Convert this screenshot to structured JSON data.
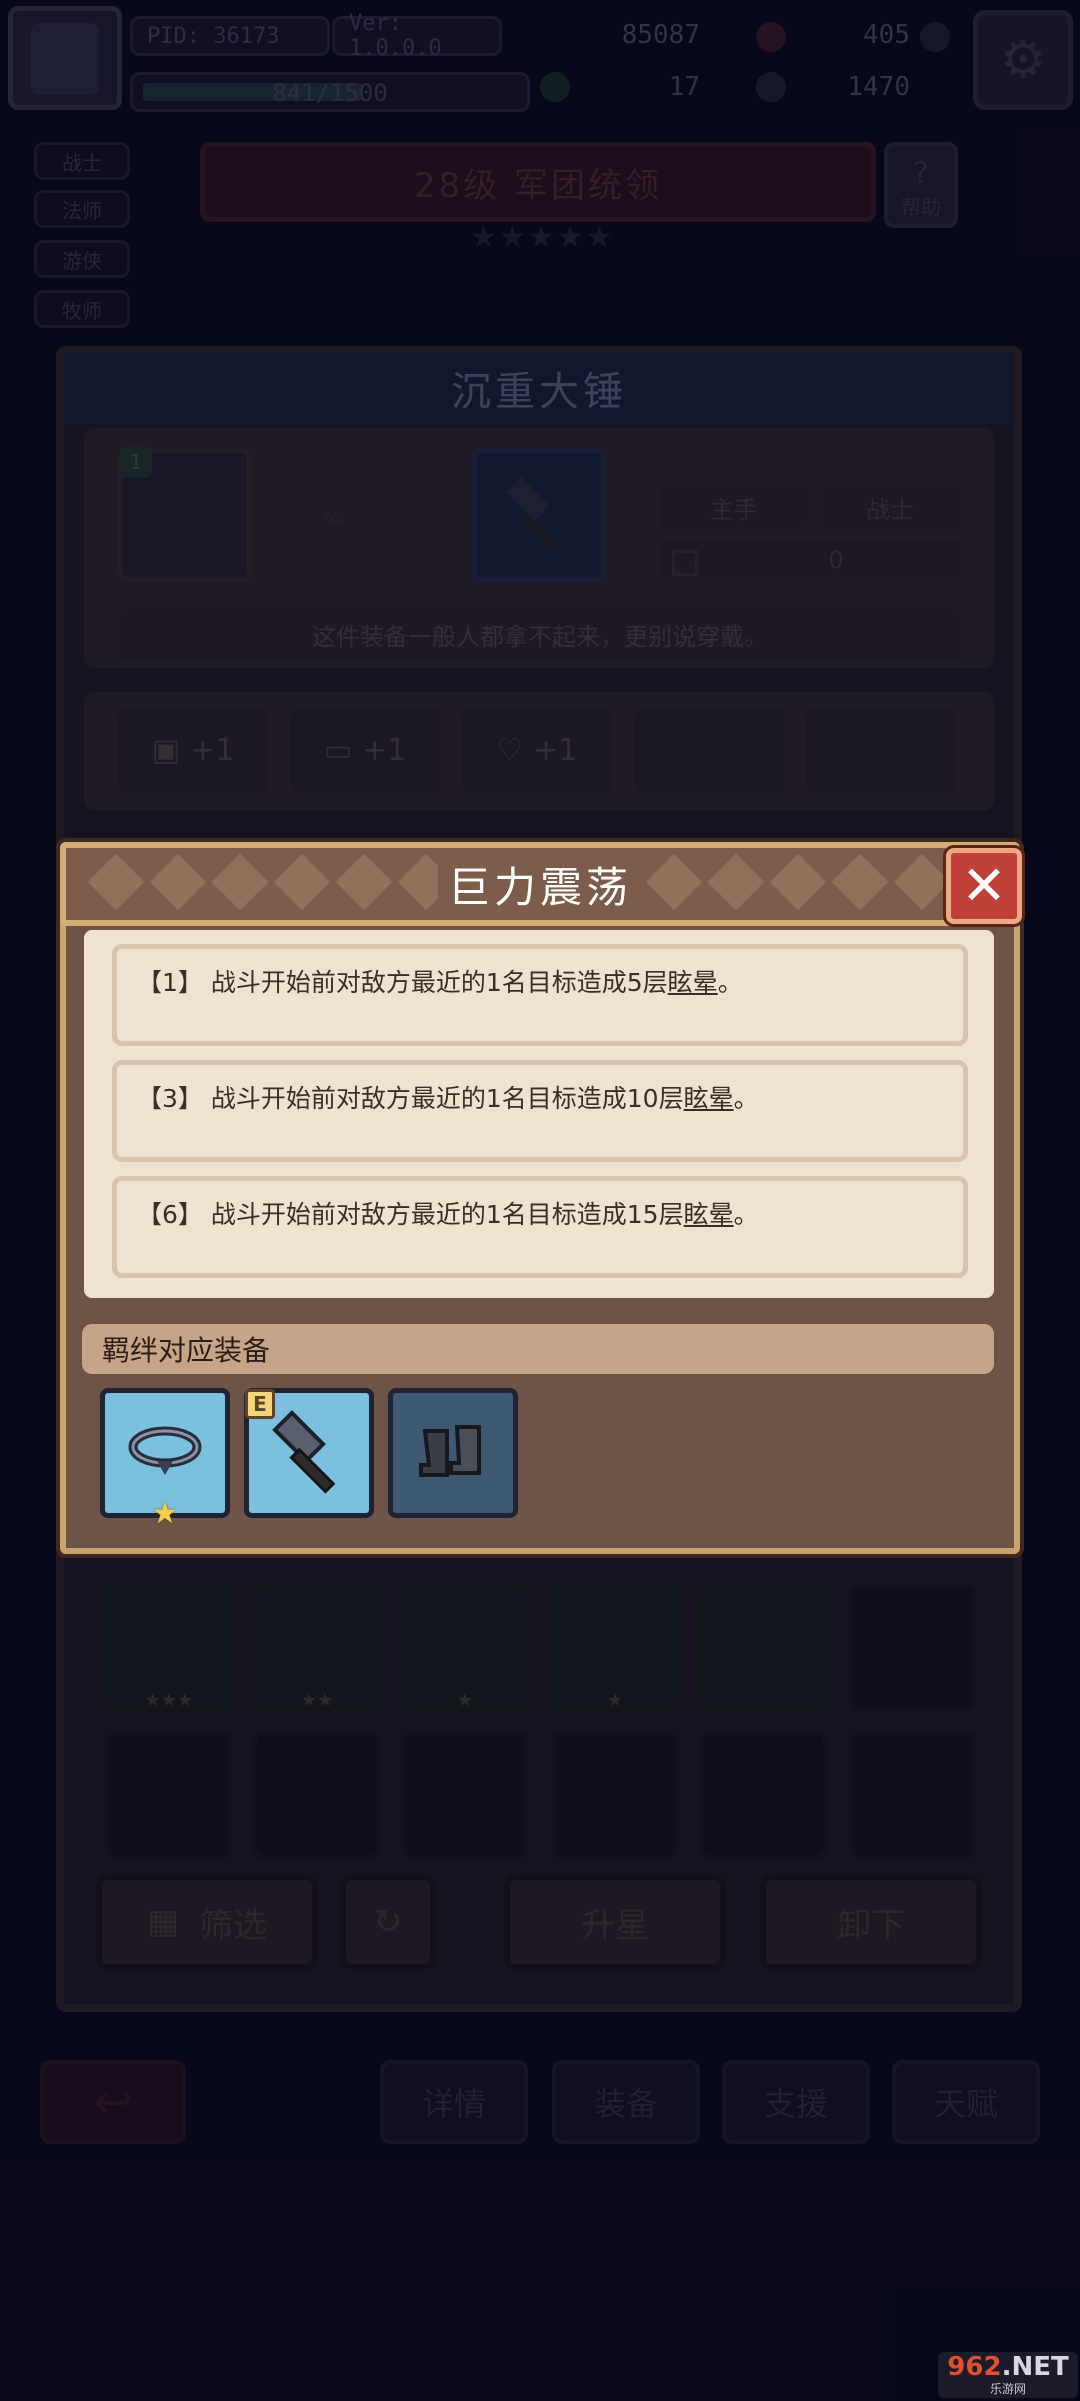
{
  "header": {
    "pid": "PID: 36173",
    "version": "Ver: 1.0.0.0",
    "xp": "841/1500",
    "gold": "85087",
    "gems": "405",
    "clover": "17",
    "potion": "1470"
  },
  "side_tabs": [
    "战士",
    "法师",
    "游侠",
    "牧师"
  ],
  "level_banner": "28级 军团统领",
  "help_label": "帮助",
  "equip": {
    "title": "沉重大锤",
    "hero_level_badge": "1",
    "slot_type": "主手",
    "class": "战士",
    "power_value": "0",
    "description": "这件装备一般人都拿不起来，更别说穿戴。",
    "stats": [
      "+1",
      "+1",
      "+1"
    ]
  },
  "inventory": {
    "stars": [
      "★★★",
      "★★",
      "★",
      "★",
      ""
    ],
    "filter_label": "筛选",
    "upgrade_label": "升星",
    "unequip_label": "卸下"
  },
  "bottom_nav": [
    "详情",
    "装备",
    "支援",
    "天赋"
  ],
  "modal": {
    "title": "巨力震荡",
    "effects": [
      {
        "prefix": "【1】 战斗开始前对敌方最近的1名目标造成5层",
        "keyword": "眩晕",
        "suffix": "。"
      },
      {
        "prefix": "【3】 战斗开始前对敌方最近的1名目标造成10层",
        "keyword": "眩晕",
        "suffix": "。"
      },
      {
        "prefix": "【6】 战斗开始前对敌方最近的1名目标造成15层",
        "keyword": "眩晕",
        "suffix": "。"
      }
    ],
    "bond_title": "羁绊对应装备",
    "bond_badge": "E",
    "bond_items": [
      "necklace-icon",
      "hammer-icon",
      "boots-icon"
    ]
  },
  "watermark": {
    "logo_a": "962",
    "logo_b": ".NET",
    "sub": "乐游网"
  }
}
